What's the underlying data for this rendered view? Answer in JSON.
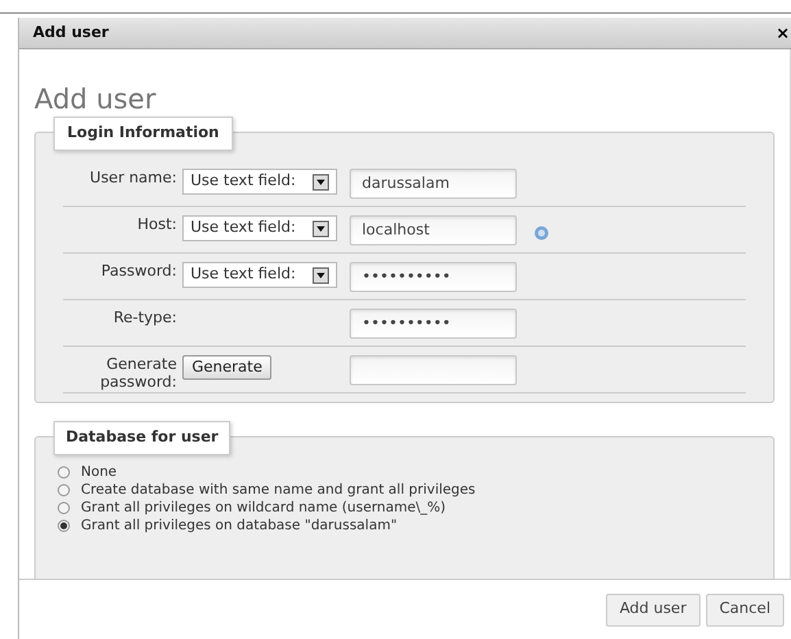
{
  "dialog": {
    "title": "Add user",
    "close": "×"
  },
  "heading": "Add user",
  "login_information": {
    "legend": "Login Information",
    "rows": [
      {
        "kind": "select",
        "label": "User name:",
        "select": "Use text field:",
        "value": "darussalam"
      },
      {
        "kind": "select",
        "label": "Host:",
        "select": "Use text field:",
        "value": "localhost",
        "help": true
      },
      {
        "kind": "select",
        "label": "Password:",
        "select": "Use text field:",
        "value": "••••••••••"
      },
      {
        "kind": "plain",
        "label": "Re-type:",
        "value": "••••••••••"
      },
      {
        "kind": "button",
        "label": "Generate password:",
        "button": "Generate",
        "value": ""
      }
    ]
  },
  "database_for_user": {
    "legend": "Database for user",
    "options": [
      {
        "label": "None",
        "selected": false
      },
      {
        "label": "Create database with same name and grant all privileges",
        "selected": false
      },
      {
        "label": "Grant all privileges on wildcard name (username\\_%)",
        "selected": false
      },
      {
        "label": "Grant all privileges on database \"darussalam\"",
        "selected": true
      }
    ]
  },
  "buttons": [
    "Add user",
    "Cancel"
  ]
}
